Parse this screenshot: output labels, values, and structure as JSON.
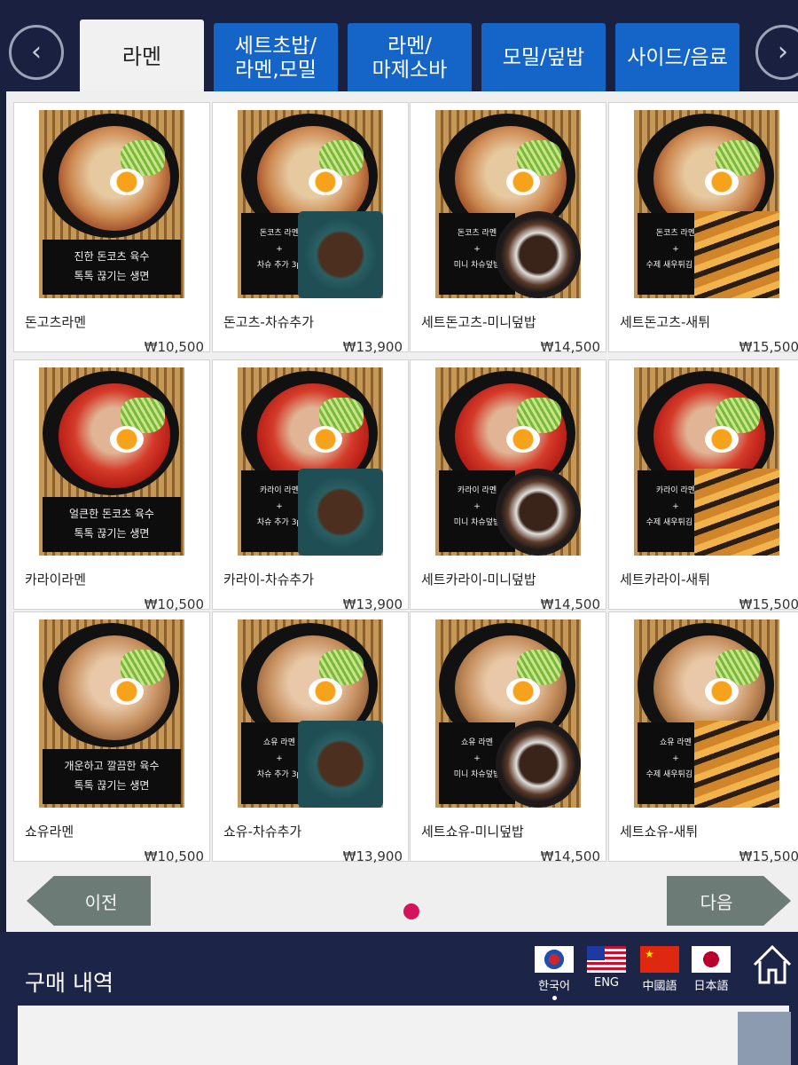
{
  "nav": {
    "prev_arrow": "‹",
    "next_arrow": "›",
    "tabs": [
      {
        "label": "라멘",
        "active": true
      },
      {
        "label": "세트초밥/\n라멘,모밀",
        "active": false
      },
      {
        "label": "라멘/\n마제소바",
        "active": false
      },
      {
        "label": "모밀/덮밥",
        "active": false
      },
      {
        "label": "사이드/음료",
        "active": false
      }
    ]
  },
  "menu": {
    "items": [
      {
        "name": "돈고츠라멘",
        "price": "₩10,500",
        "broth": "tonkotsu",
        "caption": [
          "진한 돈코츠 육수",
          "톡톡 끊기는 생면"
        ],
        "side": ""
      },
      {
        "name": "돈고츠-차슈추가",
        "price": "₩13,900",
        "broth": "tonkotsu",
        "caption": [
          "돈코츠 라멘",
          "+",
          "차슈 추가 3p"
        ],
        "side": "chashu"
      },
      {
        "name": "세트돈고츠-미니덮밥",
        "price": "₩14,500",
        "broth": "tonkotsu",
        "caption": [
          "돈코츠 라멘",
          "+",
          "미니 차슈덮밥"
        ],
        "side": "don"
      },
      {
        "name": "세트돈고츠-새튀",
        "price": "₩15,500",
        "broth": "tonkotsu",
        "caption": [
          "돈코츠 라멘",
          "+",
          "수제 새우튀김 3p"
        ],
        "side": "shrimp"
      },
      {
        "name": "카라이라멘",
        "price": "₩10,500",
        "broth": "red",
        "caption": [
          "얼큰한 돈코츠 육수",
          "톡톡 끊기는 생면"
        ],
        "side": ""
      },
      {
        "name": "카라이-차슈추가",
        "price": "₩13,900",
        "broth": "red",
        "caption": [
          "카라이 라멘",
          "+",
          "차슈 추가 3p"
        ],
        "side": "chashu"
      },
      {
        "name": "세트카라이-미니덮밥",
        "price": "₩14,500",
        "broth": "red",
        "caption": [
          "카라이 라멘",
          "+",
          "미니 차슈덮밥"
        ],
        "side": "don"
      },
      {
        "name": "세트카라이-새튀",
        "price": "₩15,500",
        "broth": "red",
        "caption": [
          "카라이 라멘",
          "+",
          "수제 새우튀김 3p"
        ],
        "side": "shrimp"
      },
      {
        "name": "쇼유라멘",
        "price": "₩10,500",
        "broth": "shoyu",
        "caption": [
          "개운하고 깔끔한 육수",
          "톡톡 끊기는 생면"
        ],
        "side": ""
      },
      {
        "name": "쇼유-차슈추가",
        "price": "₩13,900",
        "broth": "shoyu",
        "caption": [
          "쇼유 라멘",
          "+",
          "차슈 추가 3p"
        ],
        "side": "chashu"
      },
      {
        "name": "세트쇼유-미니덮밥",
        "price": "₩14,500",
        "broth": "shoyu",
        "caption": [
          "쇼유 라멘",
          "+",
          "미니 차슈덮밥"
        ],
        "side": "don"
      },
      {
        "name": "세트쇼유-새튀",
        "price": "₩15,500",
        "broth": "shoyu",
        "caption": [
          "쇼유 라멘",
          "+",
          "수제 새우튀김 3p"
        ],
        "side": "shrimp"
      }
    ]
  },
  "pager": {
    "prev_label": "이전",
    "next_label": "다음",
    "current_page": 1
  },
  "bottom": {
    "purchase_title": "구매 내역",
    "languages": [
      {
        "label": "한국어",
        "flag": "kr",
        "selected": true
      },
      {
        "label": "ENG",
        "flag": "us",
        "selected": false
      },
      {
        "label": "中國語",
        "flag": "cn",
        "selected": false
      },
      {
        "label": "日本語",
        "flag": "jp",
        "selected": false
      }
    ],
    "home_icon": "home-icon"
  },
  "colors": {
    "tab_blue": "#1565c8",
    "background": "#18203a",
    "page_dot": "#d4145a",
    "pager_button": "#6d7b76"
  }
}
